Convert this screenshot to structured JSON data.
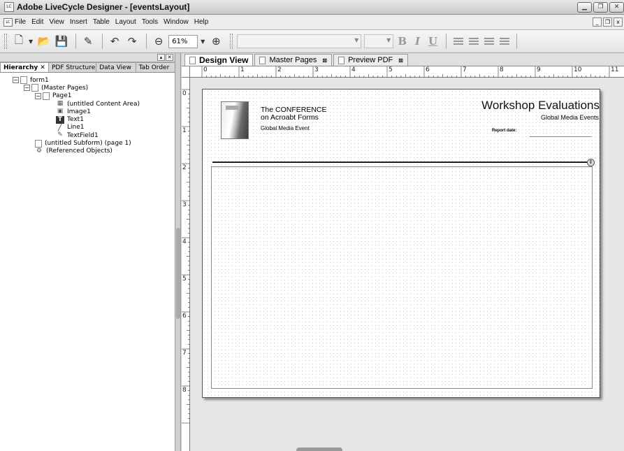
{
  "window": {
    "title": "Adobe LiveCycle Designer - [eventsLayout]",
    "app_icon": "LC"
  },
  "menu": [
    "File",
    "Edit",
    "View",
    "Insert",
    "Table",
    "Layout",
    "Tools",
    "Window",
    "Help"
  ],
  "toolbar": {
    "zoom": "61%",
    "bold": "B",
    "italic": "I",
    "underline": "U"
  },
  "hierarchy": {
    "tabs": [
      "Hierarchy",
      "PDF Structure",
      "Data View",
      "Tab Order"
    ],
    "items": [
      {
        "label": "form1",
        "icon": "form-icon"
      },
      {
        "label": "(Master Pages)",
        "icon": "master-pages-icon"
      },
      {
        "label": "Page1",
        "icon": "page-icon"
      },
      {
        "label": "(untitled Content Area)",
        "icon": "content-area-icon"
      },
      {
        "label": "Image1",
        "icon": "image-icon"
      },
      {
        "label": "Text1",
        "icon": "text-icon"
      },
      {
        "label": "Line1",
        "icon": "line-icon"
      },
      {
        "label": "TextField1",
        "icon": "textfield-icon"
      },
      {
        "label": "(untitled Subform) (page 1)",
        "icon": "subform-icon"
      },
      {
        "label": "(Referenced Objects)",
        "icon": "referenced-objects-icon"
      }
    ]
  },
  "doc_tabs": [
    "Design View",
    "Master Pages",
    "Preview PDF"
  ],
  "ruler": {
    "h_labels": [
      "0",
      "1",
      "2",
      "3",
      "4",
      "5",
      "6",
      "7",
      "8",
      "9",
      "10",
      "11"
    ],
    "v_labels": [
      "0",
      "1",
      "2",
      "3",
      "4",
      "5",
      "6",
      "7",
      "8"
    ]
  },
  "page": {
    "conference_line1": "The CONFERENCE",
    "conference_line2": "on Acroabt Forms",
    "conference_line3": "Global Media Event",
    "title": "Workshop Evaluations",
    "subtitle": "Global Media Events",
    "report_date_label": "Report date:"
  }
}
